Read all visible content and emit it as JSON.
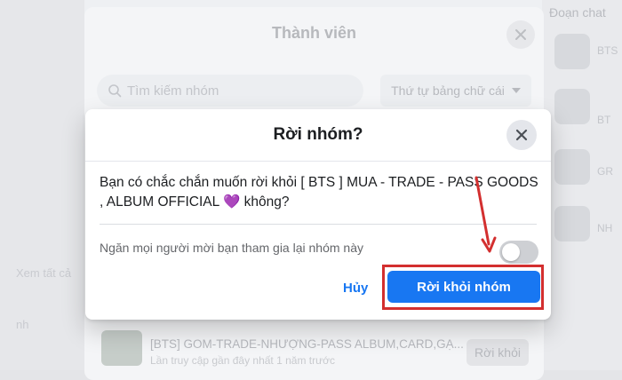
{
  "background": {
    "members_dialog": {
      "title": "Thành viên",
      "search_placeholder": "Tìm kiếm nhóm",
      "sort_label": "Thứ tự bảng chữ cái"
    },
    "right_panel": {
      "title": "Đoạn chat",
      "snippets": [
        "BTS",
        "BT",
        "GR",
        "NH"
      ]
    },
    "left_panel": {
      "snippets": [
        "Xem tất cả",
        "nh"
      ]
    },
    "group_row": {
      "name": "[BTS] GOM-TRADE-NHƯỢNG-PASS ALBUM,CARD,GẠ...",
      "subtitle": "Lần truy cập gần đây nhất 1 năm trước",
      "button_label": "Rời khỏi"
    }
  },
  "modal": {
    "title": "Rời nhóm?",
    "message_prefix": "Bạn có chắc chắn muốn rời khỏi [ BTS ] MUA - TRADE - PASS GOODS , ALBUM OFFICIAL",
    "message_emoji": "💜",
    "message_suffix": "không?",
    "toggle_label": "Ngăn mọi người mời bạn tham gia lại nhóm này",
    "toggle_on": false,
    "cancel_label": "Hủy",
    "confirm_label": "Rời khỏi nhóm"
  },
  "colors": {
    "primary": "#1877f2",
    "annotation": "#d32f2f",
    "heart": "#9b5fe0"
  }
}
